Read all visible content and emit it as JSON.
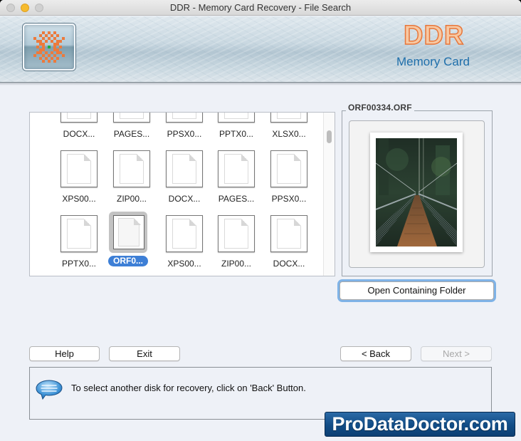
{
  "window": {
    "title": "DDR - Memory Card Recovery - File Search"
  },
  "banner": {
    "logo_icon": "ddr-logo-icon",
    "brand": "DDR",
    "product": "Memory Card"
  },
  "file_grid": {
    "rows": [
      [
        {
          "label": "DOCX...",
          "selected": false
        },
        {
          "label": "PAGES...",
          "selected": false
        },
        {
          "label": "PPSX0...",
          "selected": false
        },
        {
          "label": "PPTX0...",
          "selected": false
        },
        {
          "label": "XLSX0...",
          "selected": false
        }
      ],
      [
        {
          "label": "XPS00...",
          "selected": false
        },
        {
          "label": "ZIP00...",
          "selected": false
        },
        {
          "label": "DOCX...",
          "selected": false
        },
        {
          "label": "PAGES...",
          "selected": false
        },
        {
          "label": "PPSX0...",
          "selected": false
        }
      ],
      [
        {
          "label": "PPTX0...",
          "selected": false
        },
        {
          "label": "ORF0...",
          "selected": true
        },
        {
          "label": "XPS00...",
          "selected": false
        },
        {
          "label": "ZIP00...",
          "selected": false
        },
        {
          "label": "DOCX...",
          "selected": false
        }
      ],
      [
        {
          "label": "",
          "selected": false
        },
        {
          "label": "",
          "selected": false
        },
        {
          "label": "",
          "selected": false
        },
        {
          "label": "",
          "selected": false
        },
        {
          "label": "",
          "selected": false
        }
      ]
    ]
  },
  "preview": {
    "file_name": "ORF00334.ORF",
    "image_description": "suspension bridge through forest",
    "open_folder_label": "Open Containing Folder"
  },
  "buttons": {
    "help": "Help",
    "exit": "Exit",
    "back": "< Back",
    "next": "Next >"
  },
  "status": {
    "icon": "speech-bubble-icon",
    "message": "To select another disk for recovery, click on 'Back' Button."
  },
  "watermark": {
    "text": "ProDataDoctor.com"
  },
  "colors": {
    "selection": "#3d7fd6",
    "brand_orange": "#e8763a",
    "brand_blue": "#1f6fab",
    "focus_ring": "#7fb3e7",
    "watermark_bg": "#114c86"
  }
}
